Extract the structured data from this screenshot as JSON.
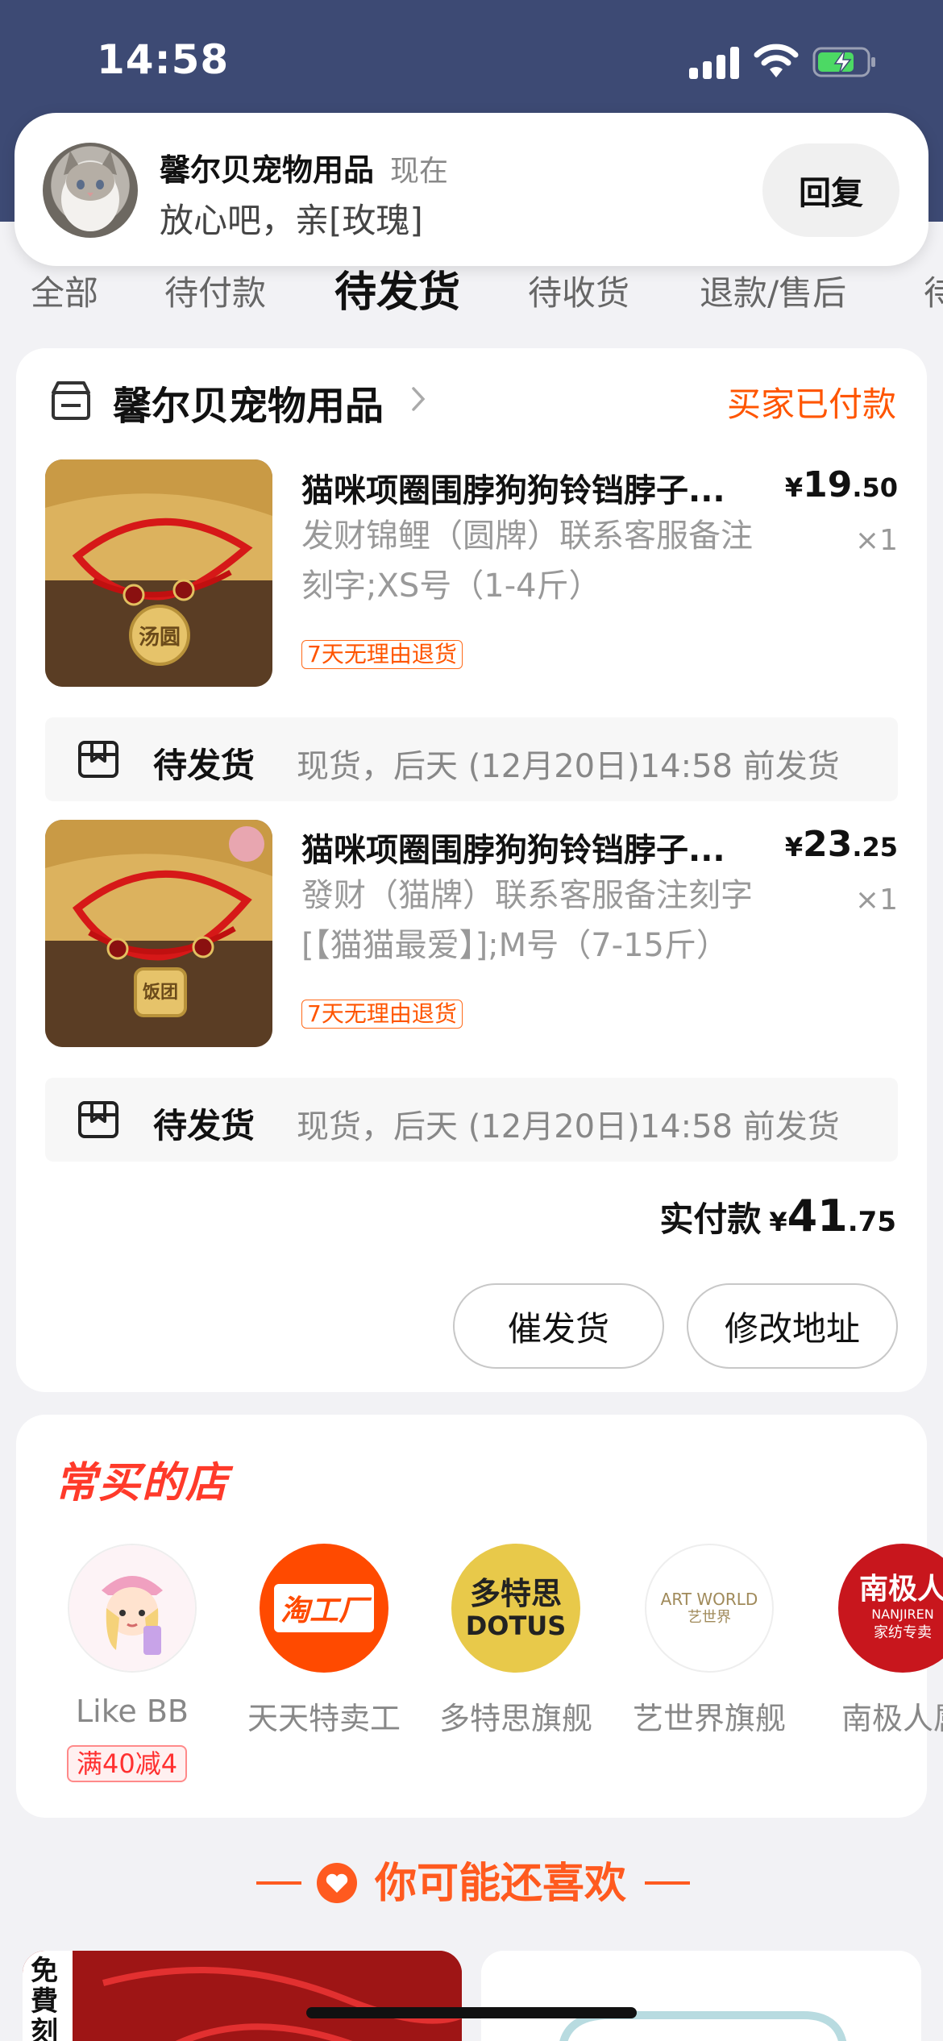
{
  "status_bar": {
    "time": "14:58"
  },
  "notification": {
    "shop_name": "馨尔贝宠物用品",
    "time_label": "现在",
    "message": "放心吧，亲[玫瑰]",
    "reply_label": "回复"
  },
  "tabs": [
    {
      "label": "全部"
    },
    {
      "label": "待付款"
    },
    {
      "label": "待发货",
      "active": true
    },
    {
      "label": "待收货"
    },
    {
      "label": "退款/售后"
    },
    {
      "label": "待"
    }
  ],
  "order": {
    "shop_name": "馨尔贝宠物用品",
    "status": "买家已付款",
    "items": [
      {
        "title": "猫咪项圈围脖狗狗铃铛脖子...",
        "price_symbol": "¥",
        "price_int": "19",
        "price_dec": ".50",
        "spec_line1": "发财锦鲤（圆牌）联系客服备注",
        "spec_line2": "刻字;XS号（1-4斤）",
        "qty": "×1",
        "tag": "7天无理由退货",
        "pendant_text": "汤圆",
        "ship_label": "待发货",
        "ship_text": "现货，后天 (12月20日)14:58 前发货"
      },
      {
        "title": "猫咪项圈围脖狗狗铃铛脖子...",
        "price_symbol": "¥",
        "price_int": "23",
        "price_dec": ".25",
        "spec_line1": "發财（猫牌）联系客服备注刻字",
        "spec_line2": "[【猫猫最爱】];M号（7-15斤）",
        "qty": "×1",
        "tag": "7天无理由退货",
        "pendant_text": "饭团",
        "ship_label": "待发货",
        "ship_text": "现货，后天 (12月20日)14:58 前发货"
      }
    ],
    "total_label": "实付款",
    "total_symbol": "¥",
    "total_int": "41",
    "total_dec": ".75",
    "buttons": {
      "urge": "催发货",
      "change_address": "修改地址"
    }
  },
  "frequent_shops": {
    "title": "常买的店",
    "shops": [
      {
        "name": "Like BB",
        "promo": "满40减4"
      },
      {
        "name": "天天特卖工",
        "logo_text": "淘工厂"
      },
      {
        "name": "多特思旗舰",
        "logo_text_1": "多特思",
        "logo_text_2": "DOTUS"
      },
      {
        "name": "艺世界旗舰",
        "logo_text_1": "ART WORLD",
        "logo_text_2": "艺世界"
      },
      {
        "name": "南极人属",
        "logo_text_1": "南极人",
        "logo_text_2": "NANJIREN",
        "logo_text_3": "家纺专卖"
      }
    ]
  },
  "recommend": {
    "title": "你可能还喜欢",
    "left_card_text": "免費刻字"
  },
  "colors": {
    "header_bg": "#3d4a74",
    "accent_orange": "#ff5500",
    "shop_title_red": "#ff3a2a",
    "page_bg": "#f2f2f5"
  }
}
